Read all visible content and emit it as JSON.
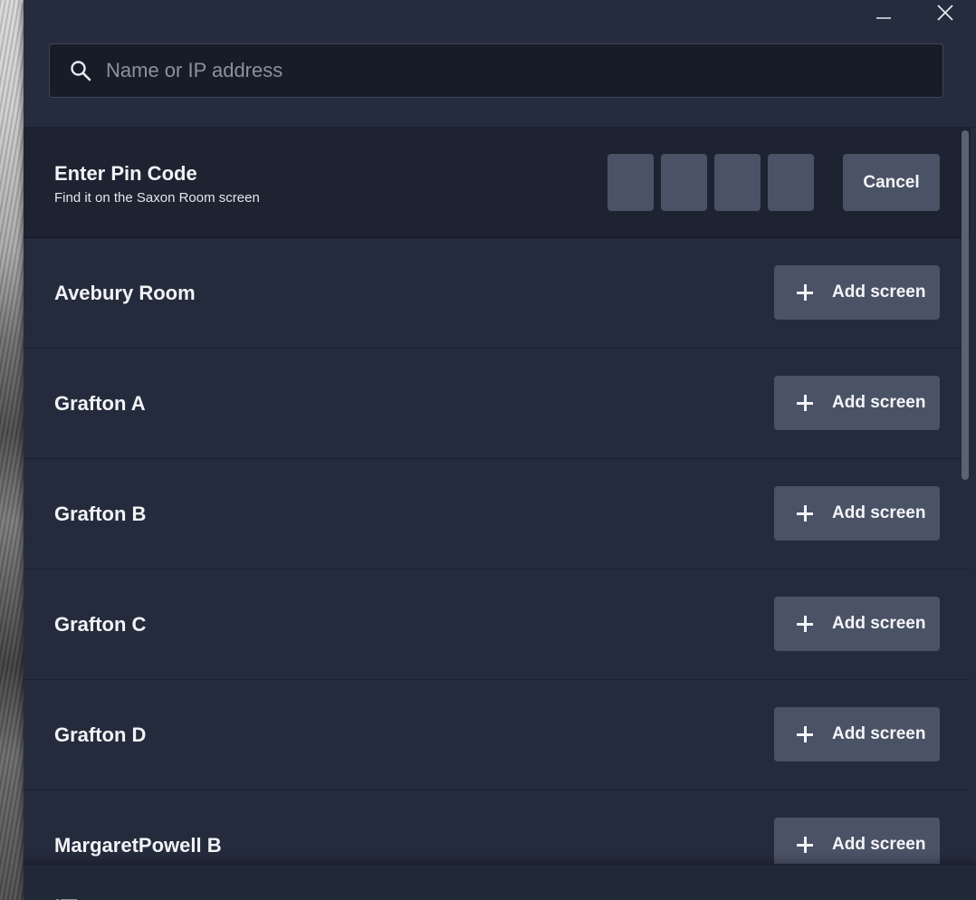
{
  "search": {
    "placeholder": "Name or IP address"
  },
  "pin": {
    "title": "Enter Pin Code",
    "subtitle": "Find it on the Saxon Room screen",
    "digits": [
      "",
      "",
      "",
      ""
    ],
    "cancel_label": "Cancel"
  },
  "rooms": [
    {
      "name": "Avebury Room",
      "action": "Add screen"
    },
    {
      "name": "Grafton A",
      "action": "Add screen"
    },
    {
      "name": "Grafton B",
      "action": "Add screen"
    },
    {
      "name": "Grafton C",
      "action": "Add screen"
    },
    {
      "name": "Grafton D",
      "action": "Add screen"
    },
    {
      "name": "MargaretPowell B",
      "action": "Add screen"
    }
  ],
  "icons": {
    "minimize": "minimize-icon",
    "close": "close-icon",
    "search": "search-icon",
    "add": "plus-icon"
  },
  "colors": {
    "window_bg": "#242b3c",
    "pin_row_bg": "#1d2331",
    "button_bg": "#4a5266",
    "text": "#f2f3f6"
  }
}
